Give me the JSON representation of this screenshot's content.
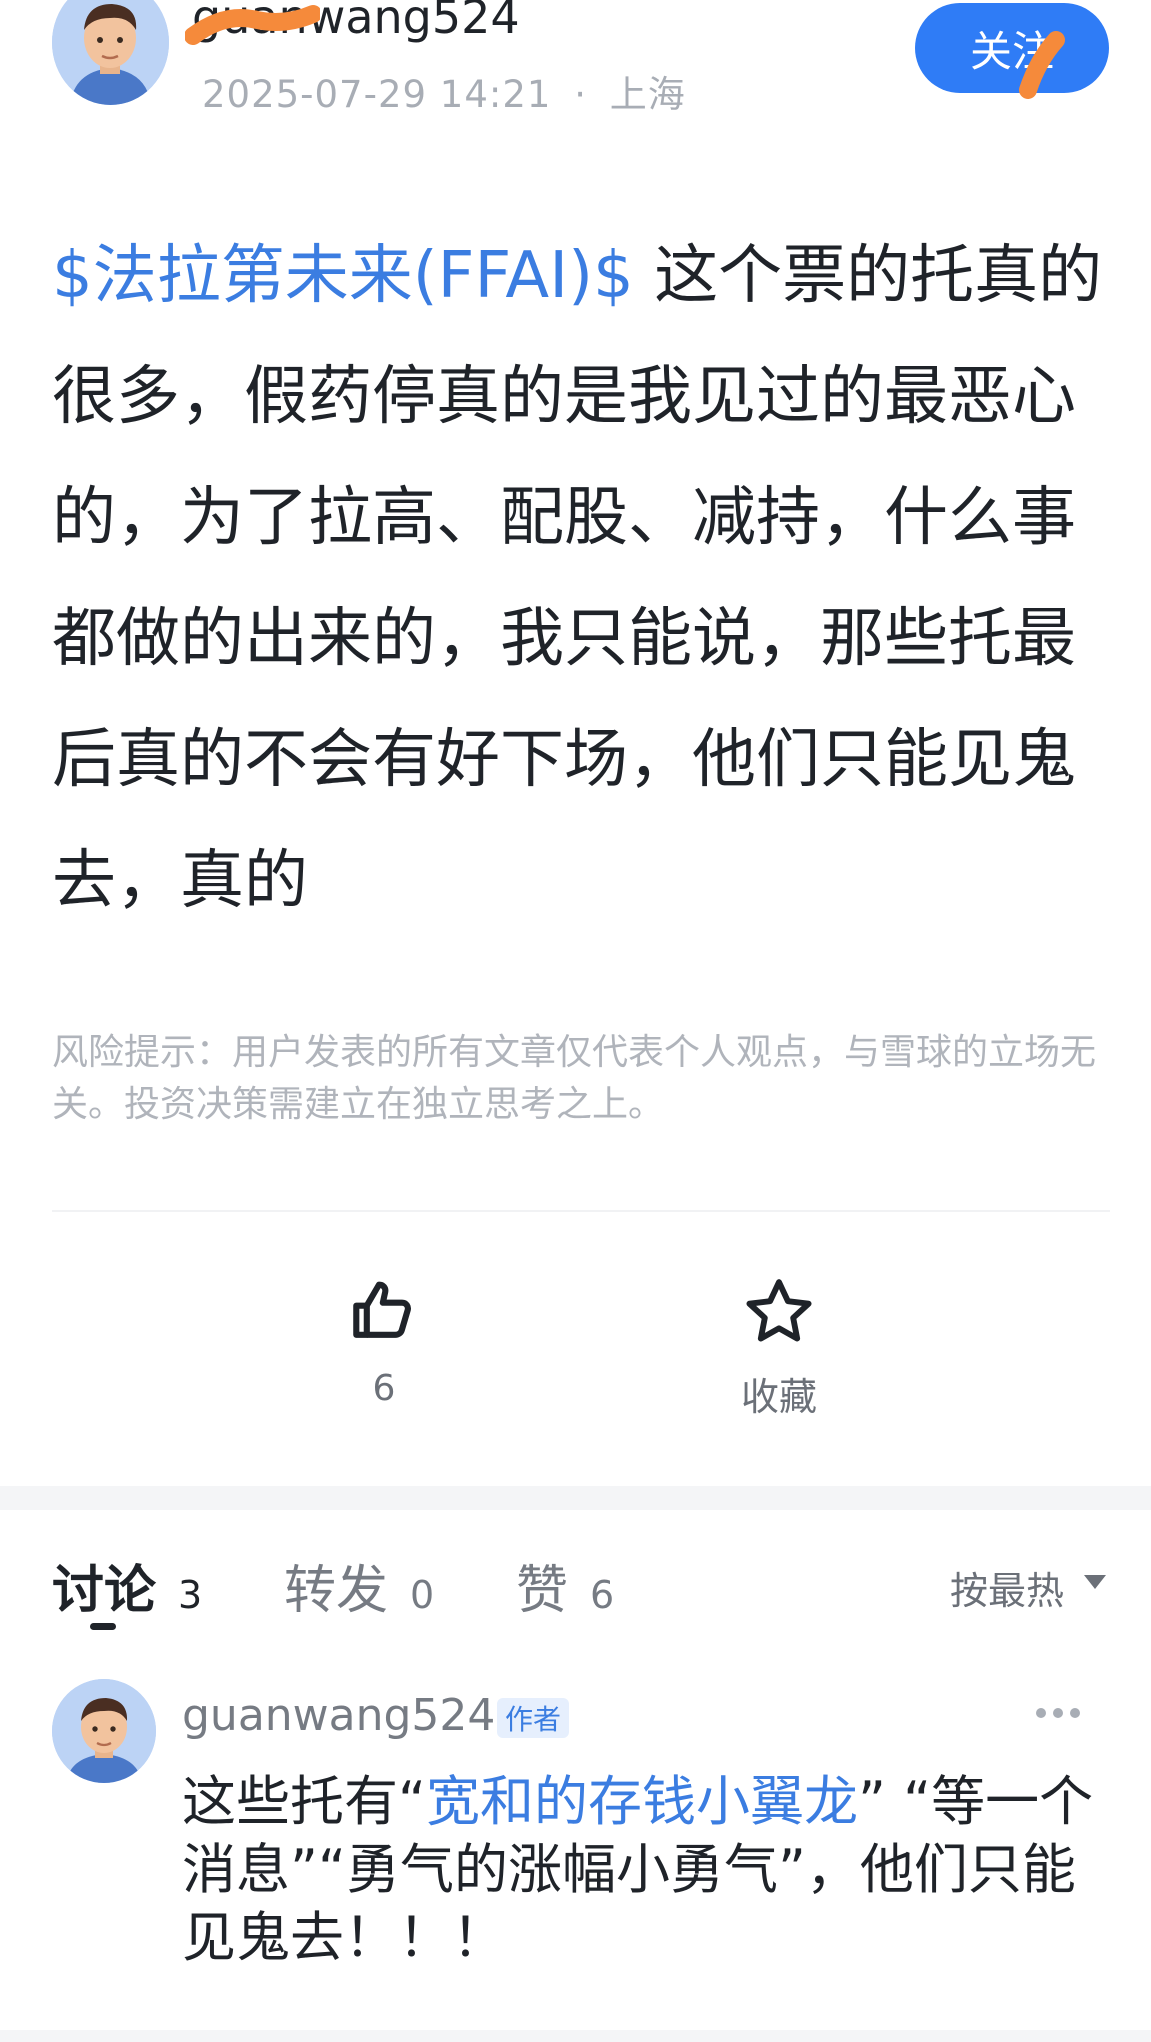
{
  "header": {
    "username": "guanwang524",
    "timestamp": "2025-07-29 14:21",
    "location": "上海",
    "separator": "·",
    "follow_label": "关注"
  },
  "post": {
    "stock_tag": "$法拉第未来(FFAI)$",
    "text": " 这个票的托真的很多，假药停真的是我见过的最恶心的，为了拉高、配股、减持，什么事都做的出来的，我只能说，那些托最后真的不会有好下场，他们只能见鬼去，真的"
  },
  "risk_notice": "风险提示：用户发表的所有文章仅代表个人观点，与雪球的立场无关。投资决策需建立在独立思考之上。",
  "actions": {
    "like_count": "6",
    "like_icon": "thumbs-up-icon",
    "favorite_label": "收藏",
    "favorite_icon": "star-icon"
  },
  "tabs": [
    {
      "label": "讨论",
      "count": "3",
      "active": true
    },
    {
      "label": "转发",
      "count": "0",
      "active": false
    },
    {
      "label": "赞",
      "count": "6",
      "active": false
    }
  ],
  "sort_label": "按最热",
  "comment": {
    "username": "guanwang524",
    "badge": "作者",
    "text_1": "这些托有“",
    "mention_1": "宽和的存钱小翼龙",
    "text_2": "” “等一个消息”“勇气的涨幅小勇气”，他们只能见鬼去！！！"
  },
  "colors": {
    "accent": "#2f7cf6",
    "link": "#3b7de1",
    "text": "#1f2329",
    "muted": "#a8adb5"
  }
}
